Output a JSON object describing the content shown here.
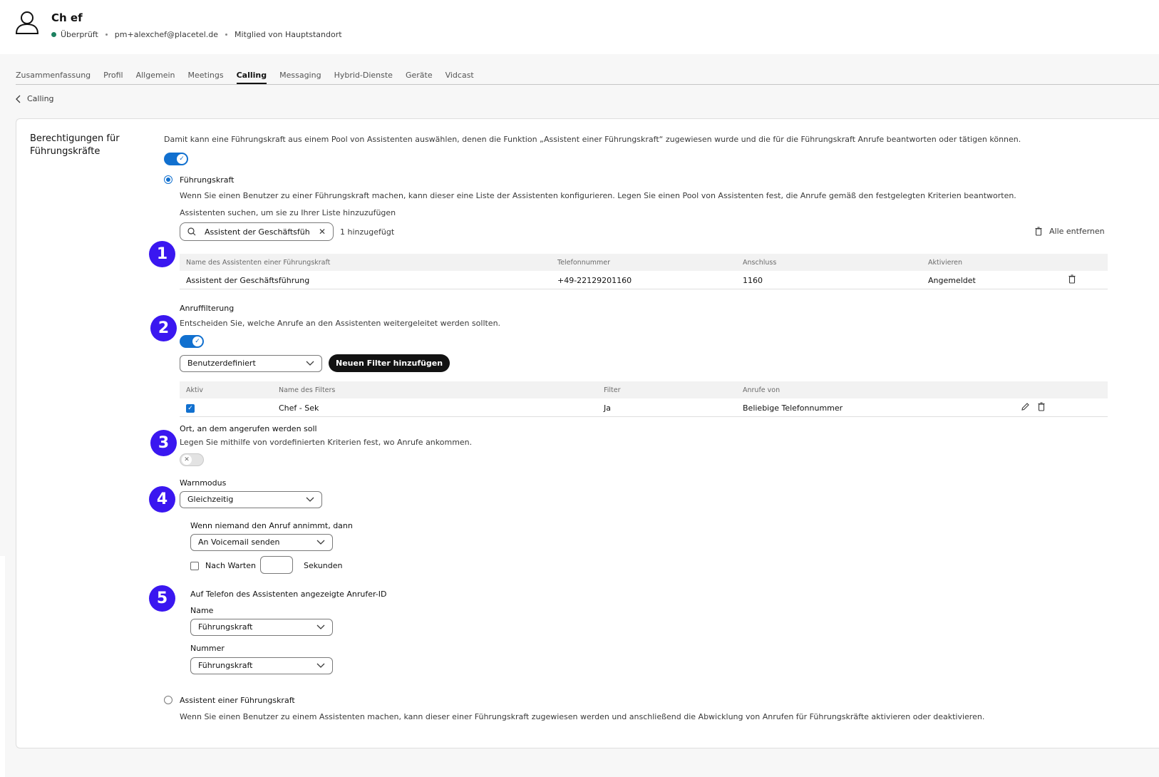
{
  "user": {
    "name": "Ch ef",
    "status": "Überprüft",
    "email": "pm+alexchef@placetel.de",
    "membership": "Mitglied von Hauptstandort"
  },
  "tabs": [
    {
      "label": "Zusammenfassung"
    },
    {
      "label": "Profil"
    },
    {
      "label": "Allgemein"
    },
    {
      "label": "Meetings"
    },
    {
      "label": "Calling",
      "active": true
    },
    {
      "label": "Messaging"
    },
    {
      "label": "Hybrid-Dienste"
    },
    {
      "label": "Geräte"
    },
    {
      "label": "Vidcast"
    }
  ],
  "breadcrumb": {
    "back_label": "Calling"
  },
  "section": {
    "title": "Berechtigungen für Führungskräfte",
    "description": "Damit kann eine Führungskraft aus einem Pool von Assistenten auswählen, denen die Funktion „Assistent einer Führungskraft“ zugewiesen wurde und die für die Führungskraft Anrufe beantworten oder tätigen können.",
    "enabled": true
  },
  "executive": {
    "radio_label": "Führungskraft",
    "selected": true,
    "description": "Wenn Sie einen Benutzer zu einer Führungskraft machen, kann dieser eine Liste der Assistenten konfigurieren. Legen Sie einen Pool von Assistenten fest, die Anrufe gemäß den festgelegten Kriterien beantworten.",
    "search_label": "Assistenten suchen, um sie zu Ihrer Liste hinzuzufügen",
    "search_value": "Assistent der Geschäftsführung",
    "added_count": "1 hinzugefügt",
    "remove_all": "Alle entfernen"
  },
  "assistants_table": {
    "headers": [
      "Name des Assistenten einer Führungskraft",
      "Telefonnummer",
      "Anschluss",
      "Aktivieren"
    ],
    "rows": [
      [
        "Assistent der Geschäftsführung",
        "+49-22129201160",
        "1160",
        "Angemeldet"
      ]
    ]
  },
  "call_filtering": {
    "title": "Anruffilterung",
    "description": "Entscheiden Sie, welche Anrufe an den Assistenten weitergeleitet werden sollten.",
    "enabled": true,
    "mode": "Benutzerdefiniert",
    "add_filter": "Neuen Filter hinzufügen",
    "headers": [
      "Aktiv",
      "Name des Filters",
      "Filter",
      "Anrufe von"
    ],
    "rows": [
      {
        "active": true,
        "name": "Chef - Sek",
        "filter": "Ja",
        "calls_from": "Beliebige Telefonnummer"
      }
    ]
  },
  "call_location": {
    "title": "Ort, an dem angerufen werden soll",
    "description": "Legen Sie mithilfe von vordefinierten Kriterien fest, wo Anrufe ankommen.",
    "enabled": false
  },
  "alert_mode": {
    "title": "Warnmodus",
    "value": "Gleichzeitig",
    "no_answer_label": "Wenn niemand den Anruf annimmt, dann",
    "no_answer_value": "An Voicemail senden",
    "wait_label": "Nach Warten",
    "wait_checked": false,
    "wait_value": "",
    "seconds_label": "Sekunden"
  },
  "caller_id": {
    "title": "Auf Telefon des Assistenten angezeigte Anrufer-ID",
    "name_label": "Name",
    "name_value": "Führungskraft",
    "number_label": "Nummer",
    "number_value": "Führungskraft"
  },
  "assistant": {
    "radio_label": "Assistent einer Führungskraft",
    "selected": false,
    "description": "Wenn Sie einen Benutzer zu einem Assistenten machen, kann dieser einer Führungskraft zugewiesen werden und anschließend die Abwicklung von Anrufen für Führungskräfte aktivieren oder deaktivieren."
  },
  "badges": [
    "1",
    "2",
    "3",
    "4",
    "5"
  ],
  "colors": {
    "accent": "#1170cf",
    "badge": "#3a17f0",
    "status_green": "#1d8160",
    "button_dark": "#121212"
  },
  "icons": [
    "user-avatar-icon",
    "chevron-left-icon",
    "search-icon",
    "close-icon",
    "trash-icon",
    "chevron-down-icon",
    "pencil-icon",
    "check-icon"
  ]
}
